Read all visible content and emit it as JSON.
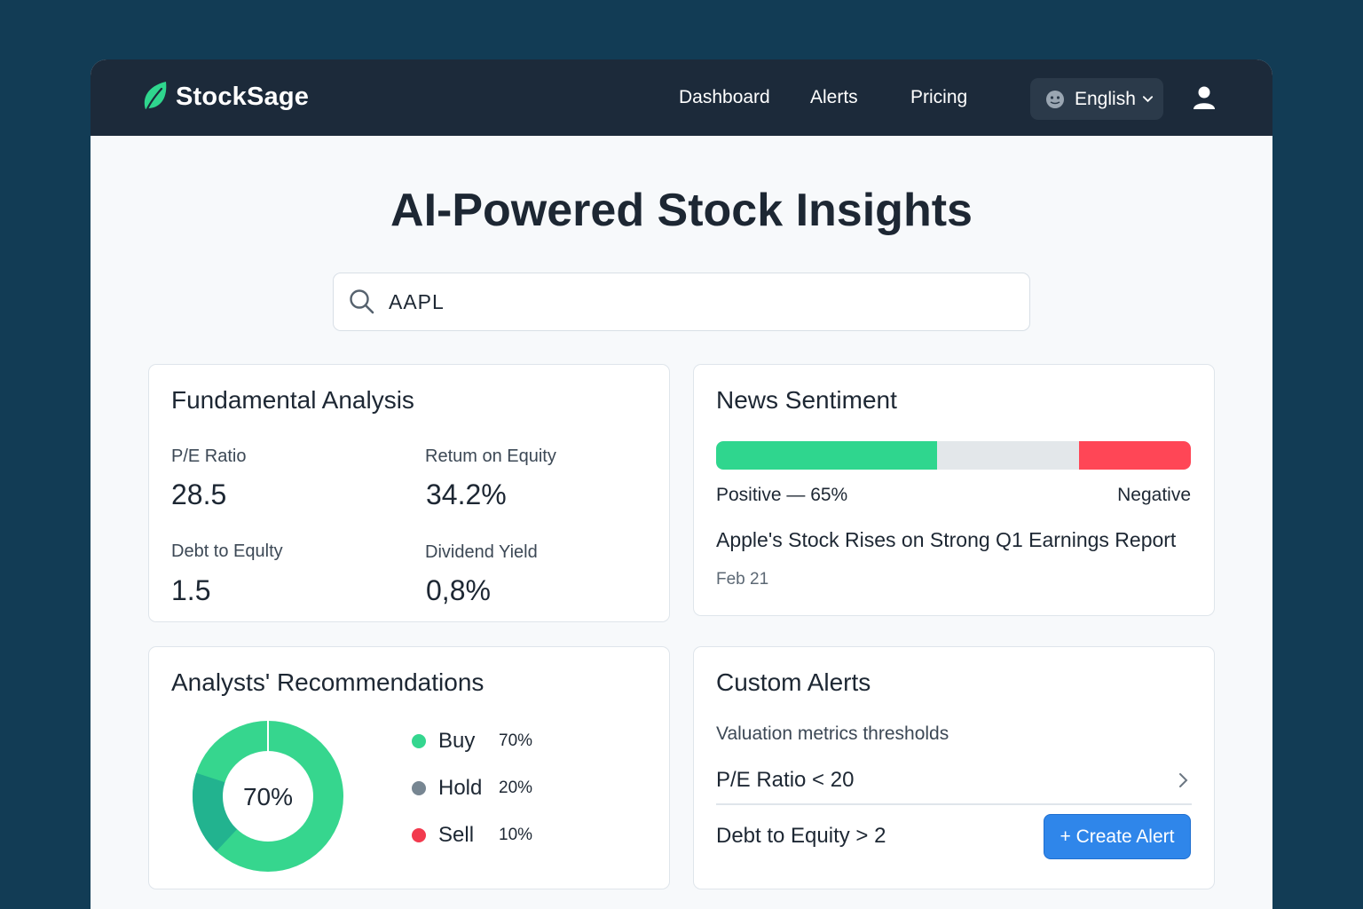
{
  "brand": {
    "name": "StockSage",
    "color": "#2fd68e"
  },
  "nav": {
    "links": [
      "Dashboard",
      "Alerts",
      "Pricing"
    ],
    "language": "English"
  },
  "hero": {
    "title": "AI-Powered Stock Insights"
  },
  "search": {
    "value": "AAPL"
  },
  "fundamental": {
    "title": "Fundamental Analysis",
    "metrics": [
      {
        "label": "P/E Ratio",
        "value": "28.5"
      },
      {
        "label": "Retum on Equity",
        "value": "34.2%"
      },
      {
        "label": "Debt to Equlty",
        "value": "1.5"
      },
      {
        "label": "Dividend Yield",
        "value": "0,8%"
      }
    ]
  },
  "news": {
    "title": "News Sentiment",
    "bar": {
      "positive": 0.465,
      "neutral": 0.3,
      "negative": 0.235
    },
    "positive_label": "Positive — 65%",
    "negative_label": "Negative",
    "headline": "Apple's Stock Rises on Strong Q1 Earnings Report",
    "date": "Feb 21"
  },
  "analysts": {
    "title": "Analysts' Recommendations",
    "center_label": "70%",
    "items": [
      {
        "name": "Buy",
        "pct": "70%",
        "value": 70,
        "color": "#34d68f"
      },
      {
        "name": "Hold",
        "pct": "20%",
        "value": 20,
        "color": "#778692"
      },
      {
        "name": "Sell",
        "pct": "10%",
        "value": 10,
        "color": "#f23a4e"
      }
    ],
    "donut_colors": {
      "main": "#36d68e",
      "secondary": "#22b38f"
    }
  },
  "alerts": {
    "title": "Custom Alerts",
    "subtitle": "Valuation metrics thresholds",
    "rows": [
      "P/E Ratio < 20",
      "Debt to Equity > 2"
    ],
    "create_label": "+ Create Alert"
  }
}
